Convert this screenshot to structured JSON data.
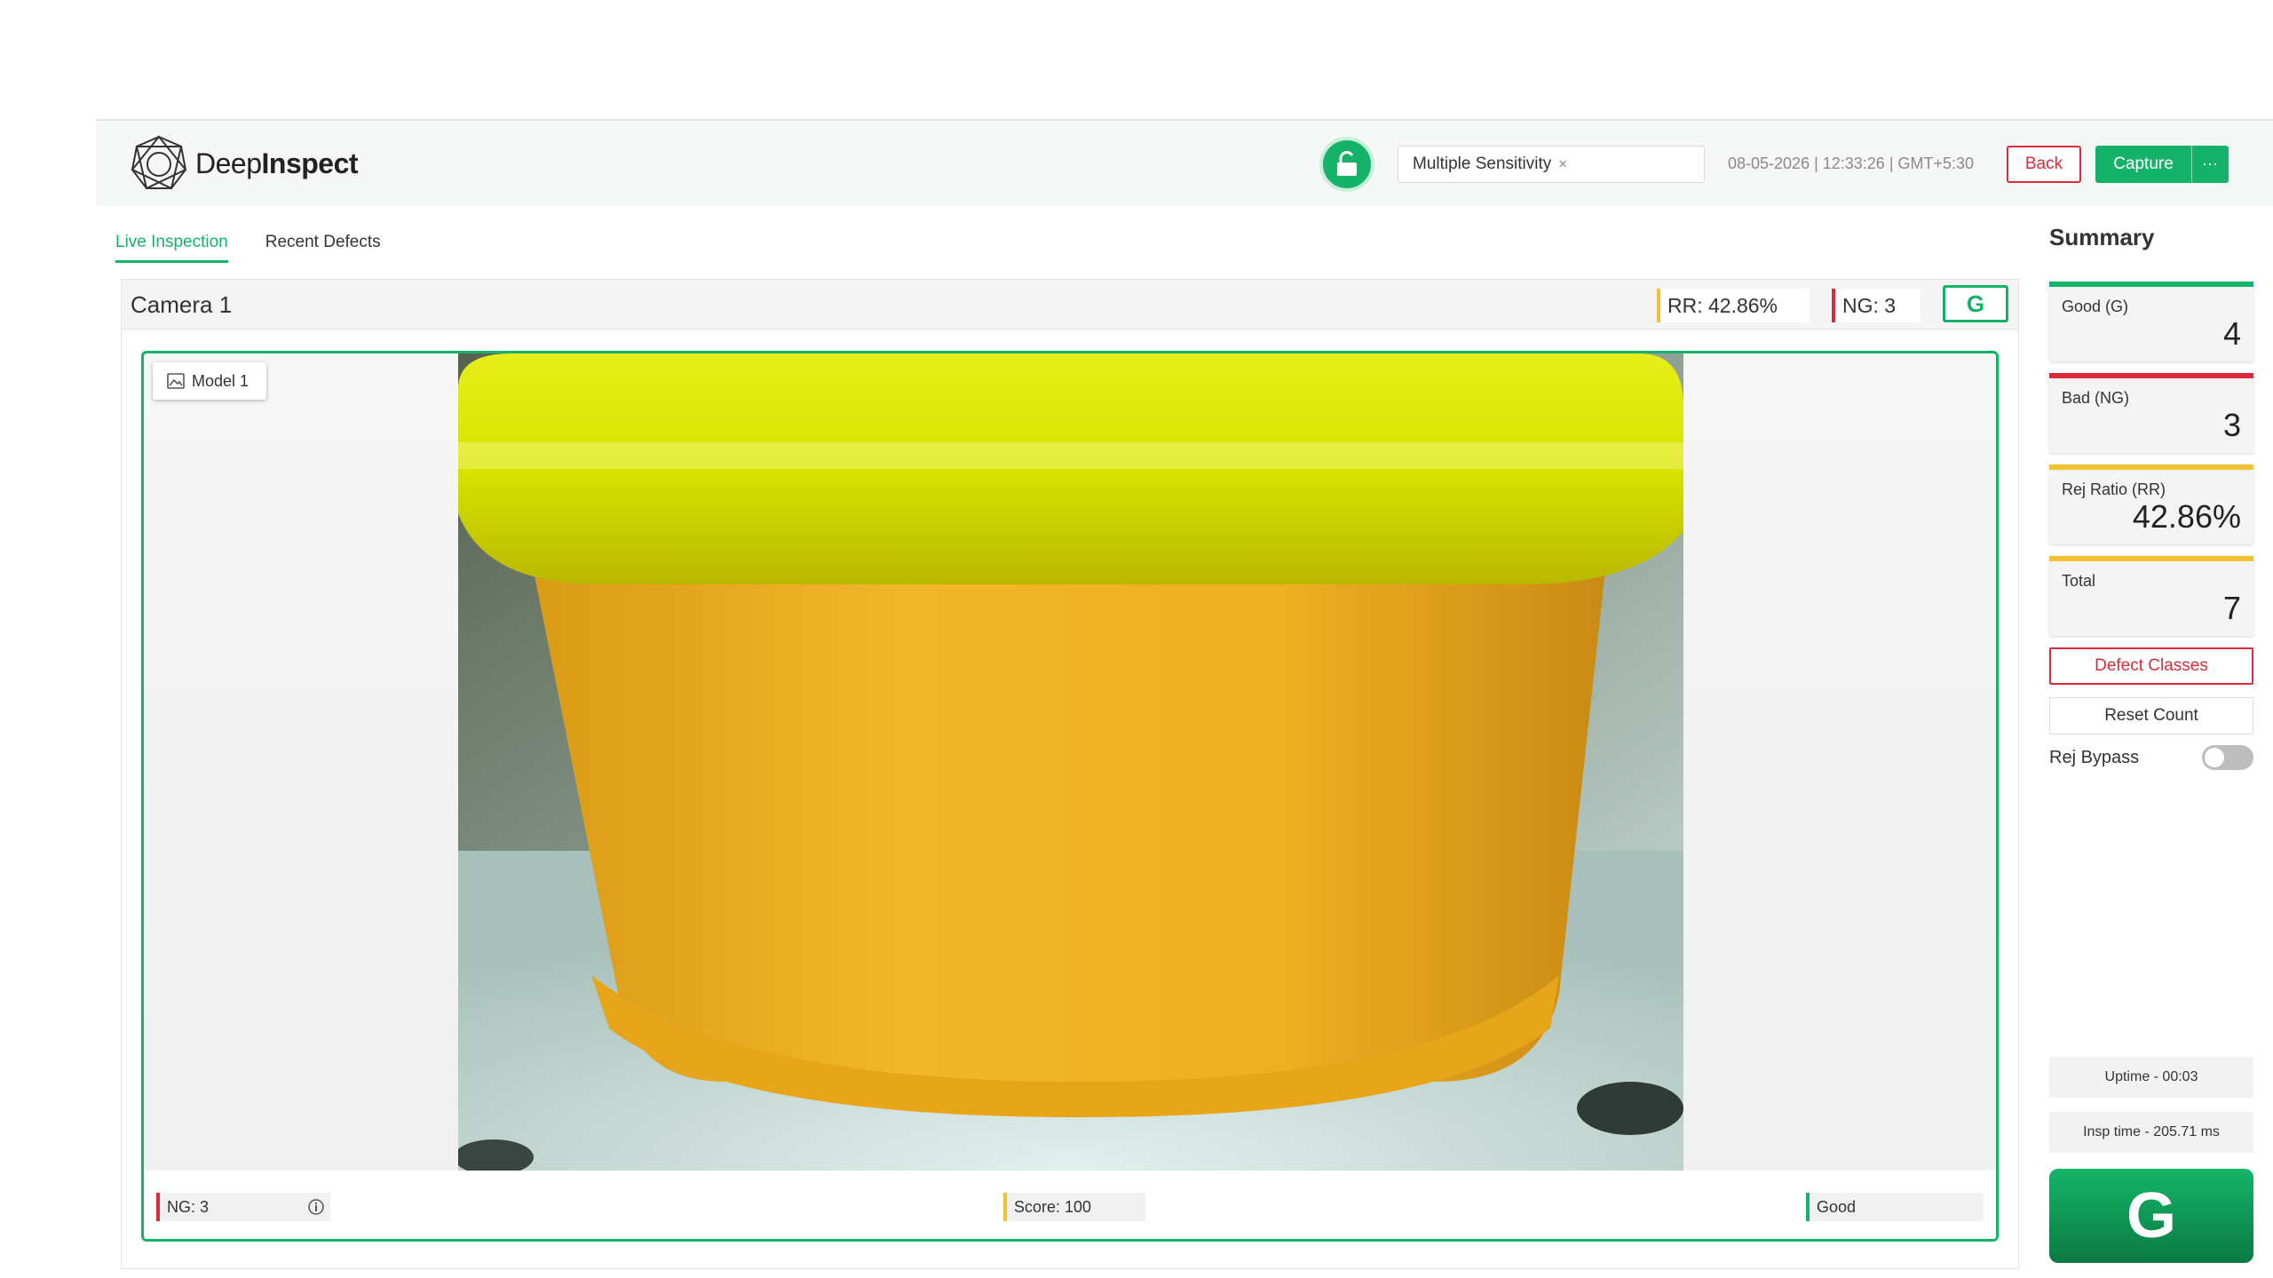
{
  "app": {
    "logo_light": "Deep",
    "logo_bold": "Inspect"
  },
  "header": {
    "sensitivity_tag": "Multiple Sensitivity",
    "sensitivity_remove": "×",
    "datetime": "08-05-2026 | 12:33:26 | GMT+5:30",
    "back_label": "Back",
    "capture_label": "Capture",
    "capture_more": "⋯"
  },
  "tabs": [
    {
      "label": "Live Inspection",
      "active": true
    },
    {
      "label": "Recent Defects",
      "active": false
    }
  ],
  "camera": {
    "title": "Camera 1",
    "rr": "RR: 42.86%",
    "ng": "NG: 3",
    "status": "G",
    "model_label": "Model 1",
    "bottom_ng": "NG: 3",
    "bottom_score": "Score: 100",
    "bottom_result": "Good"
  },
  "summary": {
    "title": "Summary",
    "cards": [
      {
        "title": "Good (G)",
        "value": "4",
        "color": "#15b26a"
      },
      {
        "title": "Bad (NG)",
        "value": "3",
        "color": "#d92b3a"
      },
      {
        "title": "Rej Ratio (RR)",
        "value": "42.86%",
        "color": "#f2c230"
      },
      {
        "title": "Total",
        "value": "7",
        "color": "#f2c230"
      }
    ],
    "defect_classes_label": "Defect Classes",
    "reset_count_label": "Reset Count",
    "rej_bypass_label": "Rej Bypass",
    "rej_bypass_on": false,
    "uptime": "Uptime - 00:03",
    "insp_time": "Insp time - 205.71 ms",
    "big_status": "G"
  },
  "colors": {
    "accent": "#15b26a",
    "danger": "#d92b3a",
    "warning": "#f2c230"
  }
}
